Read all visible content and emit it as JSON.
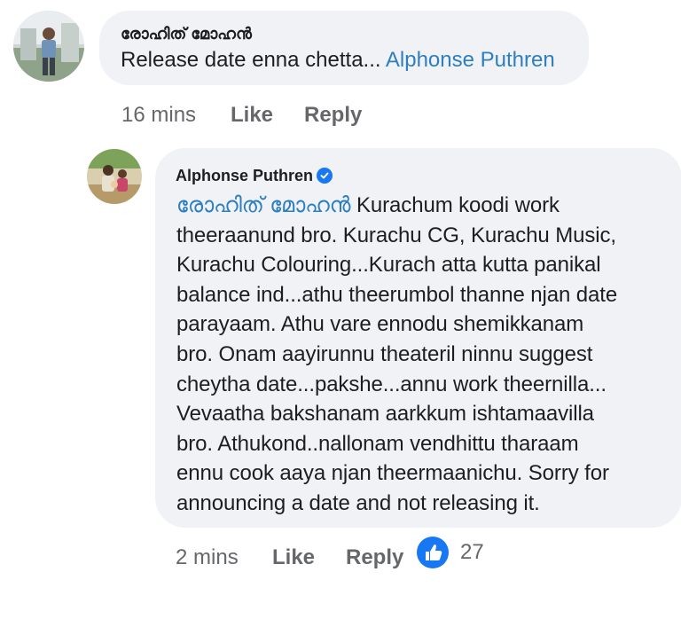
{
  "comment1": {
    "author": "രോഹിത് മോഹൻ",
    "text": "Release date enna chetta...",
    "mention": "Alphonse Puthren",
    "time": "16 mins",
    "like_label": "Like",
    "reply_label": "Reply"
  },
  "comment2": {
    "author": "Alphonse Puthren",
    "verified": true,
    "mention": "രോഹിത് മോഹൻ",
    "first_line_rest": "Kurachum koodi work",
    "lines": [
      "theeraanund bro. Kurachu CG, Kurachu Music,",
      "Kurachu Colouring...Kurach atta kutta panikal",
      "balance ind...athu theerumbol thanne njan date",
      "parayaam. Athu vare ennodu shemikkanam",
      "bro. Onam aayirunnu theateril ninnu suggest",
      "cheytha date...pakshe...annu work theernilla...",
      "Vevaatha bakshanam aarkkum ishtamaavilla",
      "bro. Athukond..nallonam vendhittu tharaam",
      "ennu cook aaya njan theermaanichu. Sorry for",
      "announcing a date and not releasing it."
    ],
    "time": "2 mins",
    "like_label": "Like",
    "reply_label": "Reply",
    "reaction_count": "27"
  },
  "colors": {
    "bubble": "#f0f2f5",
    "mention": "#2d7fc1",
    "meta": "#65676b",
    "like_reaction": "#1877f2"
  }
}
